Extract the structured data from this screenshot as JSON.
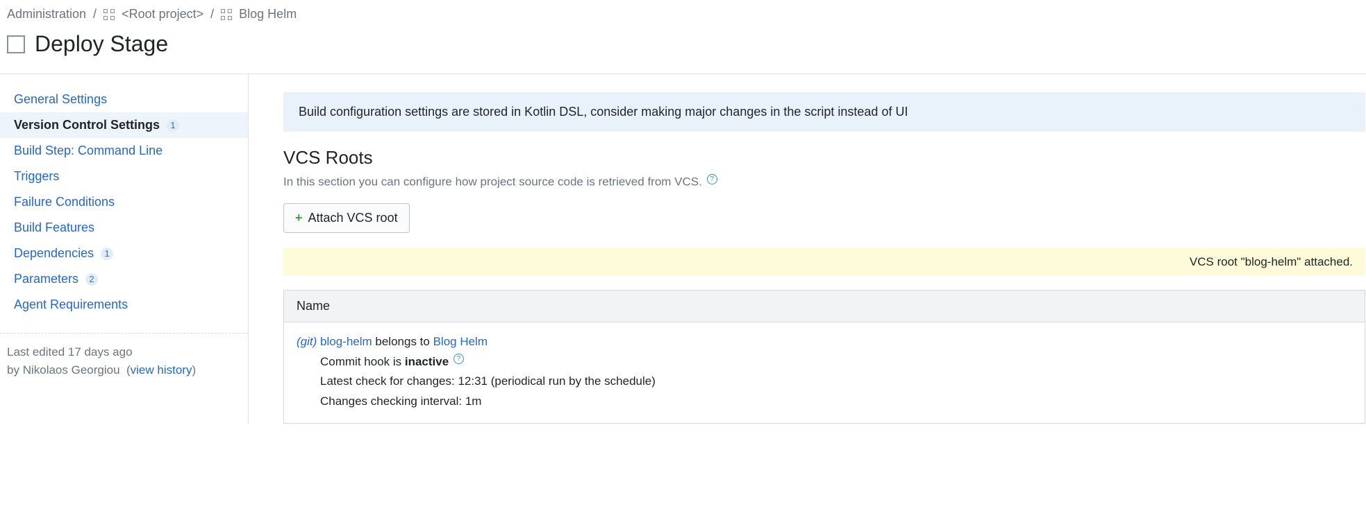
{
  "breadcrumb": {
    "admin": "Administration",
    "root": "<Root project>",
    "project": "Blog Helm"
  },
  "page_title": "Deploy Stage",
  "sidebar": {
    "items": [
      {
        "label": "General Settings",
        "badge": null
      },
      {
        "label": "Version Control Settings",
        "badge": "1"
      },
      {
        "label": "Build Step: Command Line",
        "badge": null
      },
      {
        "label": "Triggers",
        "badge": null
      },
      {
        "label": "Failure Conditions",
        "badge": null
      },
      {
        "label": "Build Features",
        "badge": null
      },
      {
        "label": "Dependencies",
        "badge": "1"
      },
      {
        "label": "Parameters",
        "badge": "2"
      },
      {
        "label": "Agent Requirements",
        "badge": null
      }
    ],
    "footer": {
      "line1_prefix": "Last edited ",
      "line1_when": "17 days ago",
      "line2_prefix": "by ",
      "editor": "Nikolaos Georgiou",
      "history_link": "view history"
    }
  },
  "main": {
    "info_banner": "Build configuration settings are stored in Kotlin DSL, consider making major changes in the script instead of UI",
    "section_heading": "VCS Roots",
    "section_desc": "In this section you can configure how project source code is retrieved from VCS.",
    "attach_button": "Attach VCS root",
    "notice": "VCS root \"blog-helm\" attached.",
    "table": {
      "header_name": "Name",
      "root": {
        "type": "(git)",
        "name": "blog-helm",
        "belongs_text": " belongs to ",
        "parent": "Blog Helm",
        "hook_prefix": "Commit hook is ",
        "hook_status": "inactive",
        "latest_check": "Latest check for changes: 12:31 (periodical run by the schedule)",
        "interval": "Changes checking interval: 1m"
      }
    }
  }
}
